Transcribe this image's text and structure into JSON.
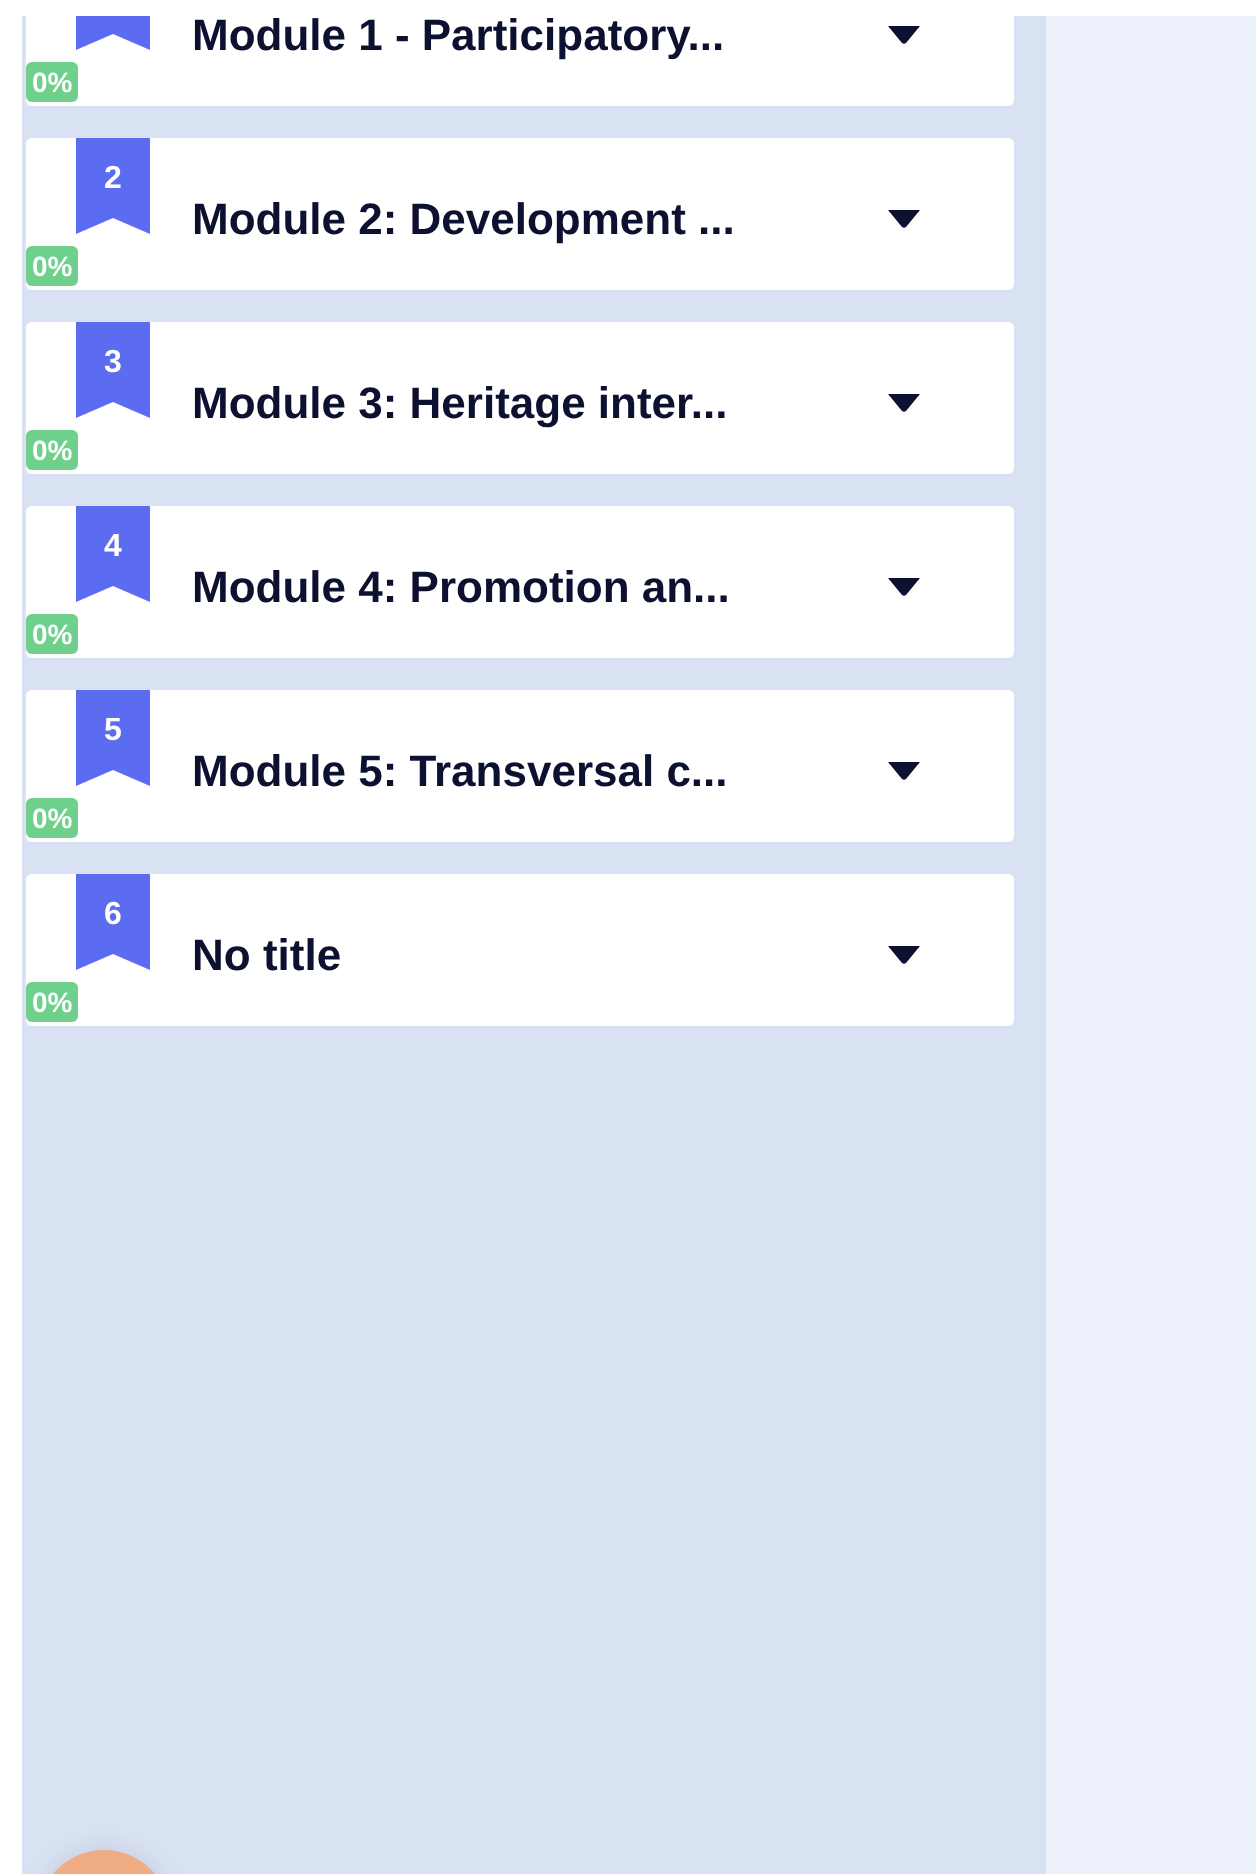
{
  "modules": [
    {
      "title": "Module 1 - Participatory...",
      "progress": "0%"
    },
    {
      "number": "2",
      "title": "Module 2: Development ...",
      "progress": "0%"
    },
    {
      "number": "3",
      "title": "Module 3: Heritage inter...",
      "progress": "0%"
    },
    {
      "number": "4",
      "title": "Module 4: Promotion an...",
      "progress": "0%"
    },
    {
      "number": "5",
      "title": "Module 5: Transversal c...",
      "progress": "0%"
    },
    {
      "number": "6",
      "title": "No title",
      "progress": "0%"
    }
  ]
}
